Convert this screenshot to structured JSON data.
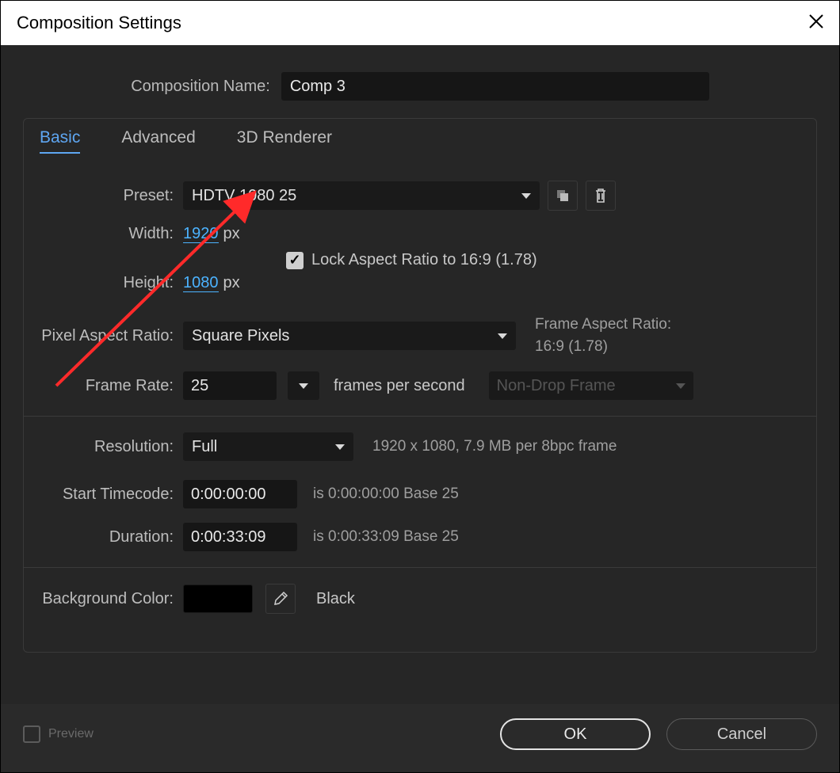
{
  "title": "Composition Settings",
  "compNameLabel": "Composition Name:",
  "compNameValue": "Comp 3",
  "tabs": {
    "basic": "Basic",
    "advanced": "Advanced",
    "renderer": "3D Renderer"
  },
  "preset": {
    "label": "Preset:",
    "value": "HDTV 1080 25"
  },
  "width": {
    "label": "Width:",
    "value": "1920",
    "unit": "px"
  },
  "height": {
    "label": "Height:",
    "value": "1080",
    "unit": "px"
  },
  "lockAspect": "Lock Aspect Ratio to 16:9 (1.78)",
  "pixelAspect": {
    "label": "Pixel Aspect Ratio:",
    "value": "Square Pixels"
  },
  "frameAspect": {
    "label": "Frame Aspect Ratio:",
    "value": "16:9 (1.78)"
  },
  "frameRate": {
    "label": "Frame Rate:",
    "value": "25",
    "suffix": "frames per second",
    "dropframe": "Non-Drop Frame"
  },
  "resolution": {
    "label": "Resolution:",
    "value": "Full",
    "hint": "1920 x 1080, 7.9 MB per 8bpc frame"
  },
  "startTimecode": {
    "label": "Start Timecode:",
    "value": "0:00:00:00",
    "hint": "is 0:00:00:00  Base 25"
  },
  "duration": {
    "label": "Duration:",
    "value": "0:00:33:09",
    "hint": "is 0:00:33:09  Base 25"
  },
  "bgcolor": {
    "label": "Background Color:",
    "name": "Black"
  },
  "footer": {
    "preview": "Preview",
    "ok": "OK",
    "cancel": "Cancel"
  }
}
